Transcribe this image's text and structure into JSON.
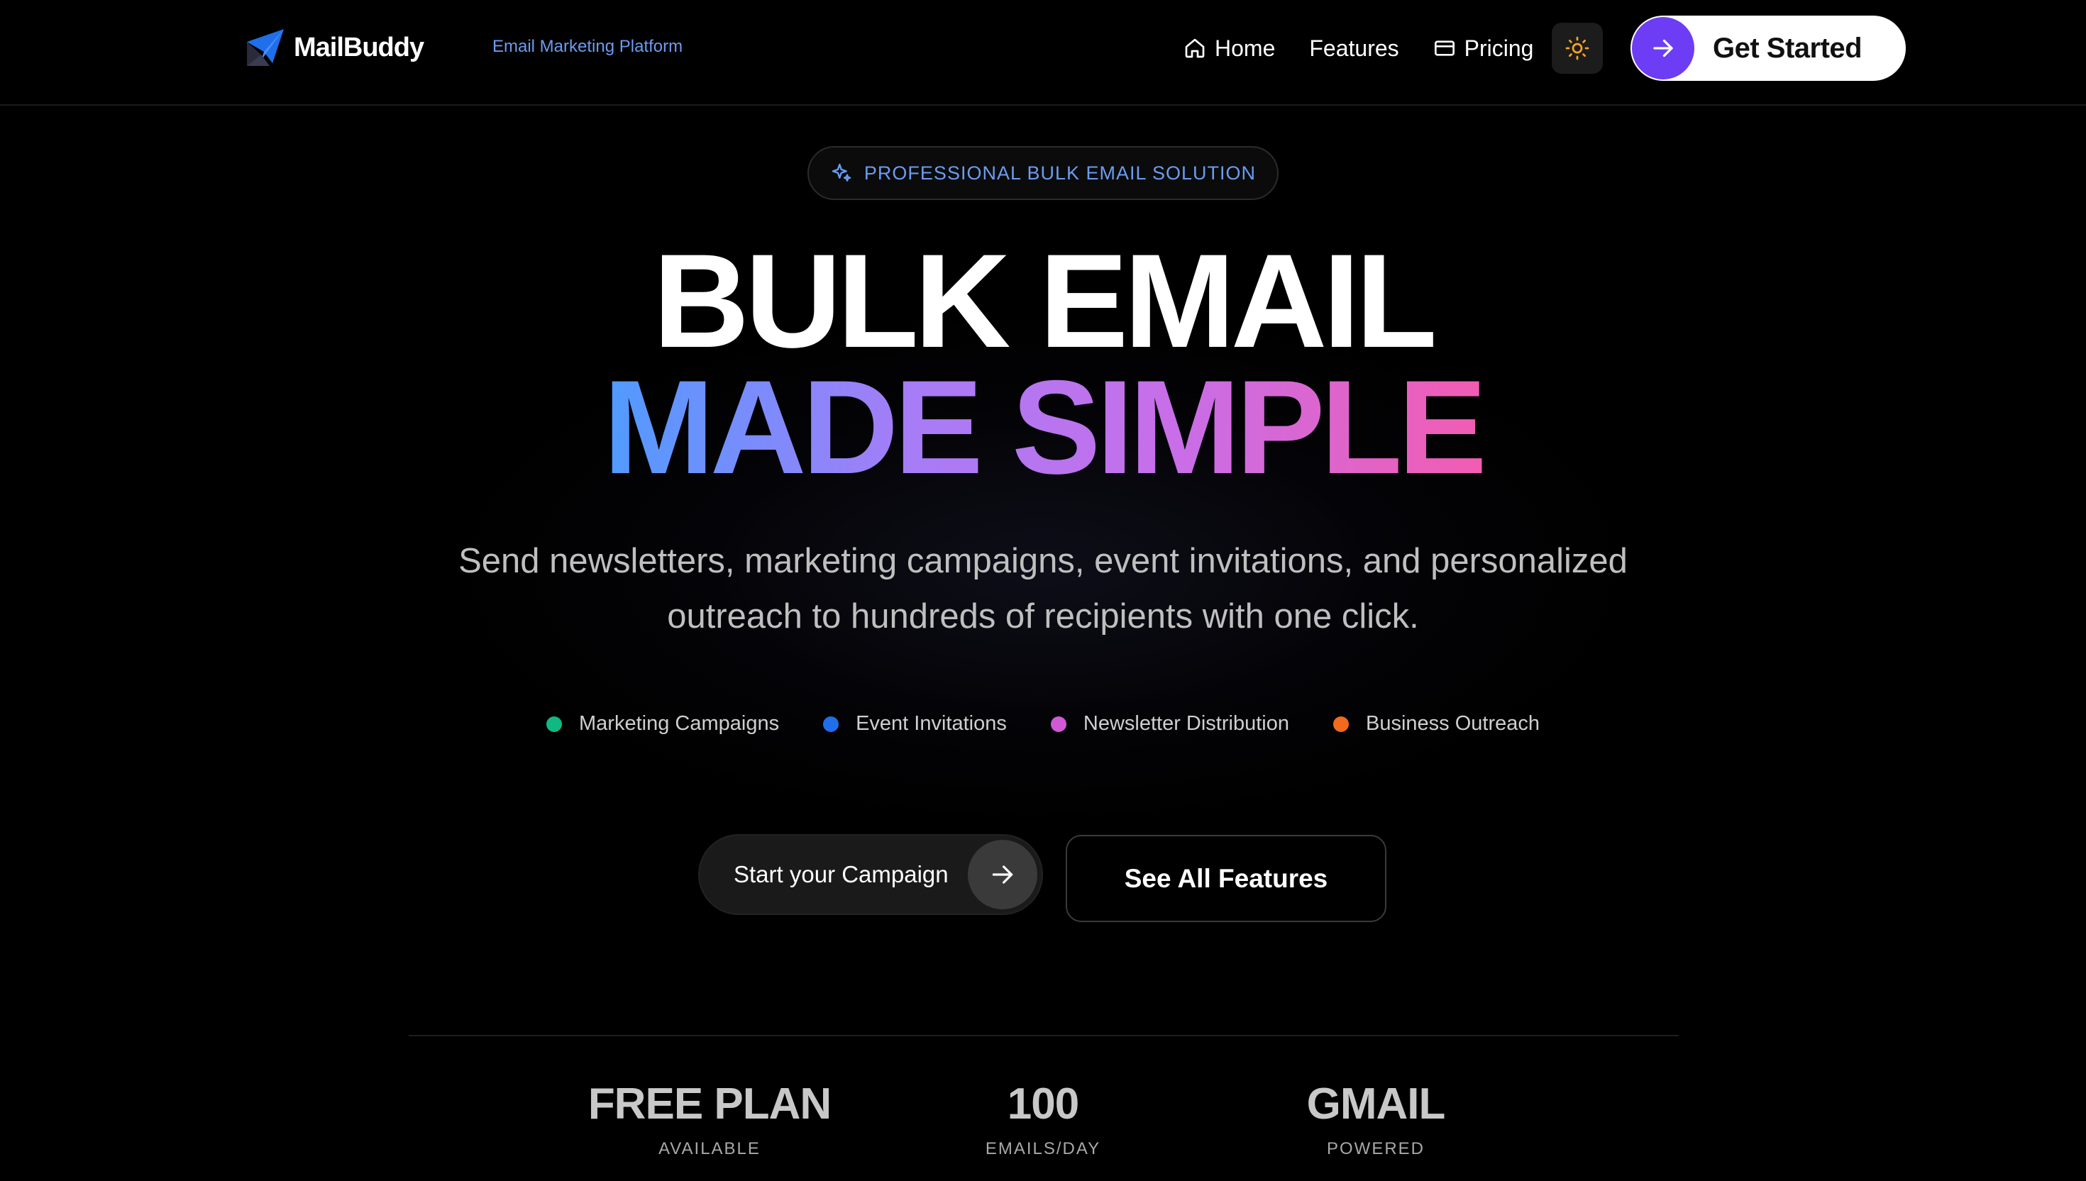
{
  "nav": {
    "brand_name": "MailBuddy",
    "tagline": "Email Marketing Platform",
    "links": [
      {
        "label": "Home",
        "icon": "home-icon"
      },
      {
        "label": "Features"
      },
      {
        "label": "Pricing",
        "icon": "credit-card-icon"
      }
    ],
    "theme_toggle_icon": "sun-icon",
    "cta_label": "Get Started"
  },
  "hero": {
    "badge": "PROFESSIONAL BULK EMAIL SOLUTION",
    "headline_line1": "BULK EMAIL",
    "headline_line2": "MADE SIMPLE",
    "subtitle": "Send newsletters, marketing campaigns, event invitations, and personalized outreach to hundreds of recipients with one click.",
    "tags": [
      {
        "label": "Marketing Campaigns",
        "color": "#10b981"
      },
      {
        "label": "Event Invitations",
        "color": "#1f6feb"
      },
      {
        "label": "Newsletter Distribution",
        "color": "#d159d8"
      },
      {
        "label": "Business Outreach",
        "color": "#f26a1b"
      }
    ],
    "primary_button": "Start your Campaign",
    "secondary_button": "See All Features"
  },
  "stats": [
    {
      "value": "FREE PLAN",
      "label": "AVAILABLE"
    },
    {
      "value": "100",
      "label": "EMAILS/DAY"
    },
    {
      "value": "GMAIL",
      "label": "POWERED"
    }
  ],
  "colors": {
    "accent_purple": "#6d3df5",
    "tagline_blue": "#6b9cf0",
    "gradient": [
      "#4f9bff",
      "#a77cf7",
      "#c86ee8",
      "#f25cb2"
    ]
  }
}
